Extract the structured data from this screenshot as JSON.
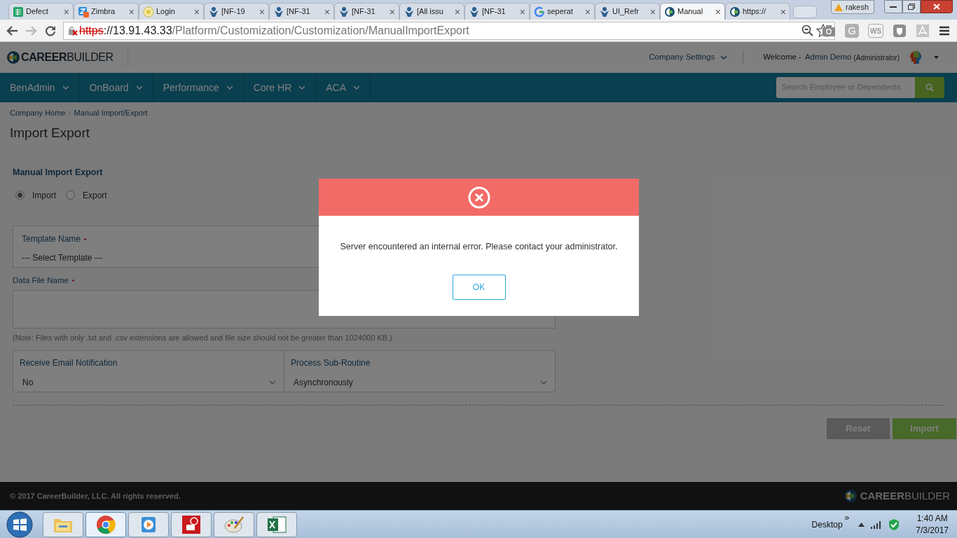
{
  "browser": {
    "tabs": [
      {
        "label": "Defect",
        "kind": "sheet",
        "selected": false
      },
      {
        "label": "Zimbra",
        "kind": "mail",
        "selected": false
      },
      {
        "label": "Login",
        "kind": "globe",
        "selected": false
      },
      {
        "label": "[NF-19",
        "kind": "jira",
        "selected": false
      },
      {
        "label": "[NF-31",
        "kind": "jira",
        "selected": false
      },
      {
        "label": "[NF-31",
        "kind": "jira",
        "selected": false
      },
      {
        "label": "[All issu",
        "kind": "jira",
        "selected": false
      },
      {
        "label": "[NF-31",
        "kind": "jira",
        "selected": false
      },
      {
        "label": "seperat",
        "kind": "google",
        "selected": false
      },
      {
        "label": "UI_Refr",
        "kind": "jira",
        "selected": false
      },
      {
        "label": "Manual",
        "kind": "site",
        "selected": true
      },
      {
        "label": "https://",
        "kind": "site",
        "selected": false
      }
    ],
    "tab_close": "×",
    "user": "rakesh",
    "url": {
      "scheme": "https",
      "host": "://13.91.43.33",
      "path": "/Platform/Customization/Customization/ManualImportExport"
    },
    "extensions": [
      {
        "kind": "camera"
      },
      {
        "kind": "g",
        "label": "G"
      },
      {
        "kind": "ws",
        "label": "WS"
      },
      {
        "kind": "shield"
      },
      {
        "kind": "pdf"
      }
    ]
  },
  "header": {
    "logo": "**CAREER**BUILDER",
    "company_settings": "Company Settings",
    "welcome": "Welcome -",
    "user_name": "Admin Demo",
    "role": "(Administrator)"
  },
  "nav": {
    "items": [
      "BenAdmin",
      "OnBoard",
      "Performance",
      "Core HR",
      "ACA"
    ],
    "search_placeholder": "Search Employee or Dependents"
  },
  "breadcrumb": [
    "Company Home",
    "Manual Import/Export"
  ],
  "page_title": "Import Export",
  "form": {
    "section": "Manual Import Export",
    "radios": [
      {
        "label": "Import",
        "selected": true
      },
      {
        "label": "Export",
        "selected": false
      }
    ],
    "template": {
      "label": "Template Name",
      "required": true,
      "value": "--- Select Template ---"
    },
    "data_file": {
      "label": "Data File Name",
      "required": true
    },
    "note": "(Note: Files with only .txt and .csv extensions are allowed and file size should not be greater than 1024000 KB.)",
    "selects": [
      {
        "label": "Receive Email Notification",
        "value": "No"
      },
      {
        "label": "Process Sub-Routine",
        "value": "Asynchronously"
      }
    ],
    "buttons": [
      {
        "label": "Reset",
        "kind": "secondary"
      },
      {
        "label": "Import",
        "kind": "primary"
      }
    ]
  },
  "footer": {
    "copyright": "© 2017 CareerBuilder, LLC. All rights reserved.",
    "logo": "**CAREER**BUILDER"
  },
  "dialog": {
    "message": "Server encountered an internal error. Please contact your administrator.",
    "button": "OK"
  },
  "taskbar": {
    "apps": [
      {
        "kind": "folder",
        "selected": false
      },
      {
        "kind": "chrome",
        "selected": true
      },
      {
        "kind": "media",
        "selected": false
      },
      {
        "kind": "remote",
        "selected": false
      },
      {
        "kind": "paint",
        "selected": false
      },
      {
        "kind": "excel",
        "selected": false
      }
    ],
    "desktop": "Desktop",
    "toolbar_arrows": "»",
    "time": "1:40 AM",
    "date": "7/3/2017"
  }
}
